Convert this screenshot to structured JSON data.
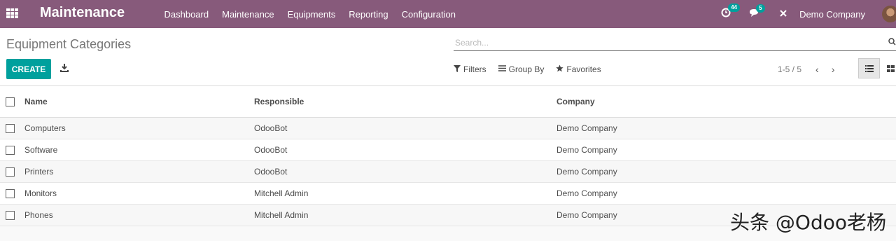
{
  "navbar": {
    "brand": "Maintenance",
    "menu": [
      "Dashboard",
      "Maintenance",
      "Equipments",
      "Reporting",
      "Configuration"
    ],
    "activity_count": "44",
    "message_count": "5",
    "company": "Demo Company"
  },
  "control": {
    "breadcrumb": "Equipment Categories",
    "search_placeholder": "Search...",
    "create_label": "CREATE",
    "filters_label": "Filters",
    "groupby_label": "Group By",
    "favorites_label": "Favorites",
    "pager": "1-5 / 5"
  },
  "table": {
    "columns": [
      "Name",
      "Responsible",
      "Company"
    ],
    "rows": [
      [
        "Computers",
        "OdooBot",
        "Demo Company"
      ],
      [
        "Software",
        "OdooBot",
        "Demo Company"
      ],
      [
        "Printers",
        "OdooBot",
        "Demo Company"
      ],
      [
        "Monitors",
        "Mitchell Admin",
        "Demo Company"
      ],
      [
        "Phones",
        "Mitchell Admin",
        "Demo Company"
      ]
    ]
  },
  "watermark": "头条 @Odoo老杨",
  "colors": {
    "navbar": "#875a7b",
    "primary": "#00a09d"
  },
  "icons": [
    "apps-grid-icon",
    "activity-clock-icon",
    "chat-icon",
    "debug-cross-icon",
    "avatar",
    "download-icon",
    "filter-icon",
    "group-by-icon",
    "star-icon",
    "chevron-left-icon",
    "chevron-right-icon",
    "list-view-icon",
    "kanban-view-icon",
    "search-icon"
  ]
}
